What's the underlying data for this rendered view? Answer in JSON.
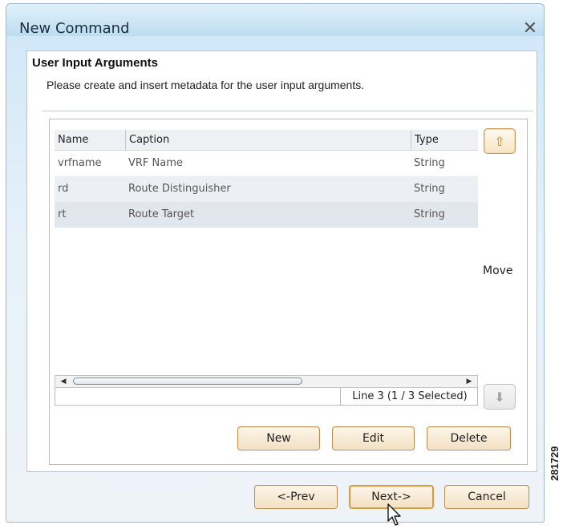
{
  "window": {
    "title": "New Command"
  },
  "header": {
    "title": "User Input Arguments",
    "subtitle": "Please create and insert metadata for the user input arguments."
  },
  "table": {
    "columns": [
      "Name",
      "Caption",
      "Type"
    ],
    "rows": [
      {
        "name": "vrfname",
        "caption": "VRF Name",
        "type": "String"
      },
      {
        "name": "rd",
        "caption": "Route Distinguisher",
        "type": "String"
      },
      {
        "name": "rt",
        "caption": "Route Target",
        "type": "String"
      }
    ],
    "selected_row": 3,
    "status": "Line 3 (1 / 3 Selected)"
  },
  "move": {
    "label": "Move",
    "up_icon": "arrow-up-icon",
    "down_icon": "arrow-down-icon"
  },
  "table_actions": {
    "new_label": "New",
    "edit_label": "Edit",
    "delete_label": "Delete"
  },
  "footer": {
    "prev_label": "<-Prev",
    "next_label": "Next->",
    "cancel_label": "Cancel"
  },
  "side_label": "281729",
  "colors": {
    "button_border": "#b98d52",
    "up_arrow": "#d4880f",
    "selected_row": "#e2e7ee"
  }
}
